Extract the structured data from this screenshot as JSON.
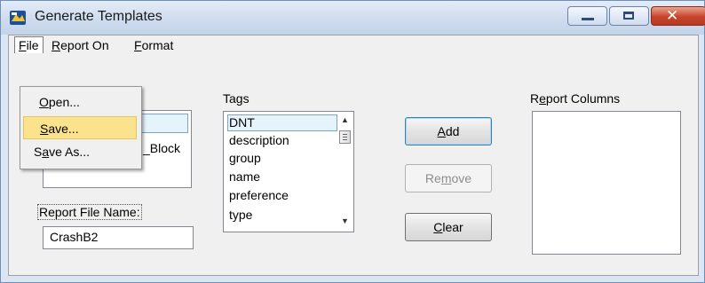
{
  "window": {
    "title": "Generate Templates"
  },
  "menubar": {
    "file": {
      "pre": "",
      "key": "F",
      "post": "ile"
    },
    "report_on": {
      "pre": "",
      "key": "R",
      "post": "eport On"
    },
    "format": {
      "pre": "",
      "key": "F",
      "post": "ormat"
    }
  },
  "file_menu": {
    "items": [
      {
        "pre": "",
        "key": "O",
        "post": "pen..."
      },
      {
        "pre": "",
        "key": "S",
        "post": "ave..."
      },
      {
        "pre": "S",
        "key": "a",
        "post": "ve As..."
      }
    ],
    "highlighted_index": 1
  },
  "left_list": {
    "visible_fragment": "_Block"
  },
  "report_file_name": {
    "label": "Report File Name:",
    "value": "CrashB2"
  },
  "tags": {
    "label": {
      "pre": "Ta",
      "key": "g",
      "post": "s"
    },
    "items": [
      "DNT",
      "description",
      "group",
      "name",
      "preference",
      "type"
    ],
    "selected_index": 0
  },
  "buttons": {
    "add": {
      "pre": "",
      "key": "A",
      "post": "dd",
      "enabled": true
    },
    "remove": {
      "pre": "Re",
      "key": "m",
      "post": "ove",
      "enabled": false
    },
    "clear": {
      "pre": "",
      "key": "C",
      "post": "lear",
      "enabled": true
    }
  },
  "report_columns": {
    "label": {
      "pre": "R",
      "key": "e",
      "post": "port Columns"
    },
    "items": []
  },
  "colors": {
    "highlight": "#fbe28d",
    "selection": "#e5f3fb",
    "close_button": "#c7442b"
  },
  "icons": [
    "app-icon",
    "minimize-icon",
    "maximize-icon",
    "close-icon",
    "scroll-up-icon",
    "scroll-down-icon"
  ]
}
